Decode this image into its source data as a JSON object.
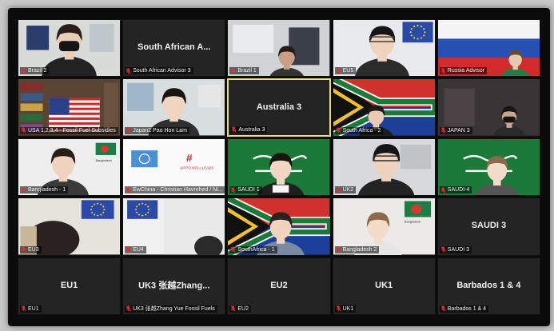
{
  "meeting": {
    "tiles": [
      {
        "name": "Brazil 2",
        "center": "",
        "scene": "girl-mask",
        "active": false
      },
      {
        "name": "South African Advisor 3",
        "center": "South African A...",
        "scene": "blank",
        "active": false
      },
      {
        "name": "Brazil 1",
        "center": "",
        "scene": "room",
        "active": false
      },
      {
        "name": "EU5",
        "center": "",
        "scene": "eu-boy",
        "active": false
      },
      {
        "name": "Russia Advisor",
        "center": "",
        "scene": "russia",
        "active": false
      },
      {
        "name": "USA 1,2,3,4 - Fossil Fuel Subsidies",
        "center": "",
        "scene": "usa",
        "active": false
      },
      {
        "name": "Japan2 Pao Hon Lam",
        "center": "",
        "scene": "boy-room",
        "active": false
      },
      {
        "name": "Australia 3",
        "center": "Australia 3",
        "scene": "blank",
        "active": true
      },
      {
        "name": "South Africa - 2",
        "center": "",
        "scene": "sa-boy",
        "active": false
      },
      {
        "name": "JAPAN 3",
        "center": "",
        "scene": "dark-room",
        "active": false
      },
      {
        "name": "Bangladesh - 1",
        "center": "",
        "scene": "bangladesh-girl",
        "active": false
      },
      {
        "name": "EwChina - Christian Havrehed / Ni...",
        "center": "",
        "scene": "un-china",
        "active": false
      },
      {
        "name": "SAUDI 1",
        "center": "",
        "scene": "saudi-girl",
        "active": false
      },
      {
        "name": "UK2",
        "center": "",
        "scene": "uk-boy",
        "active": false
      },
      {
        "name": "SAUDI-4",
        "center": "",
        "scene": "saudi-girl2",
        "active": false
      },
      {
        "name": "EU3",
        "center": "",
        "scene": "eu-hair",
        "active": false
      },
      {
        "name": "EU4",
        "center": "",
        "scene": "eu-flag",
        "active": false
      },
      {
        "name": "SouthAfrica - 1",
        "center": "",
        "scene": "sa-boy2",
        "active": false
      },
      {
        "name": "Bangladesh 2",
        "center": "",
        "scene": "bangladesh-girl2",
        "active": false
      },
      {
        "name": "SAUDI 3",
        "center": "SAUDI 3",
        "scene": "blank",
        "active": false
      },
      {
        "name": "EU1",
        "center": "EU1",
        "scene": "blank",
        "active": false
      },
      {
        "name": "UK3 张越Zhang Yue Fossil Fuels",
        "center": "UK3 张越Zhang...",
        "scene": "blank",
        "active": false
      },
      {
        "name": "EU2",
        "center": "EU2",
        "scene": "blank",
        "active": false
      },
      {
        "name": "UK1",
        "center": "UK1",
        "scene": "blank",
        "active": false
      },
      {
        "name": "Barbados 1 & 4",
        "center": "Barbados 1 & 4",
        "scene": "blank",
        "active": false
      }
    ],
    "colors": {
      "muted_mic": "#e0312f",
      "active_speaker_border": "#e7e07a",
      "tile_background": "#242424"
    },
    "icons": {
      "mic": "muted-microphone-icon"
    }
  }
}
